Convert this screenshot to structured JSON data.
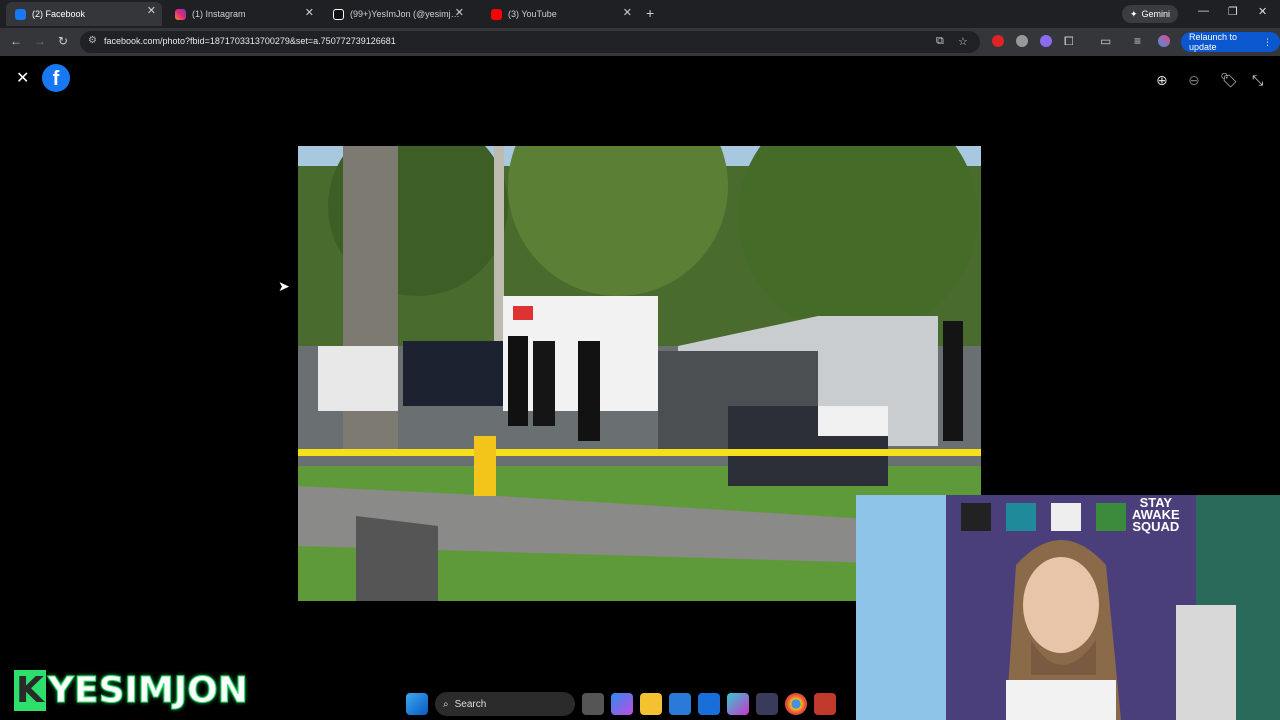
{
  "browser": {
    "tabs": [
      {
        "label": "(2) Facebook",
        "favicon_color": "#1877f2",
        "active": true
      },
      {
        "label": "(1) Instagram",
        "favicon_color": "#e1306c",
        "active": false
      },
      {
        "label": "(99+)YesImJon (@yesimjon) | Ti",
        "favicon_color": "#ffffff",
        "active": false
      },
      {
        "label": "(3) YouTube",
        "favicon_color": "#ff0000",
        "active": false
      }
    ],
    "new_tab": "+",
    "gemini_label": "Gemini",
    "url": "facebook.com/photo?fbid=1871703313700279&set=a.750772739126681",
    "relaunch_label": "Relaunch to update"
  },
  "viewer": {
    "close_glyph": "✕",
    "logo_glyph": "f",
    "tools": [
      "zoom-in-icon",
      "zoom-out-icon",
      "tag-icon",
      "fullscreen-exit-icon"
    ]
  },
  "taskbar": {
    "search_label": "Search"
  },
  "overlay": {
    "brand_first": "K",
    "brand_rest": "YESIMJON",
    "poster_line1": "STAY",
    "poster_line2": "AWAKE",
    "poster_line3": "SQUAD"
  }
}
